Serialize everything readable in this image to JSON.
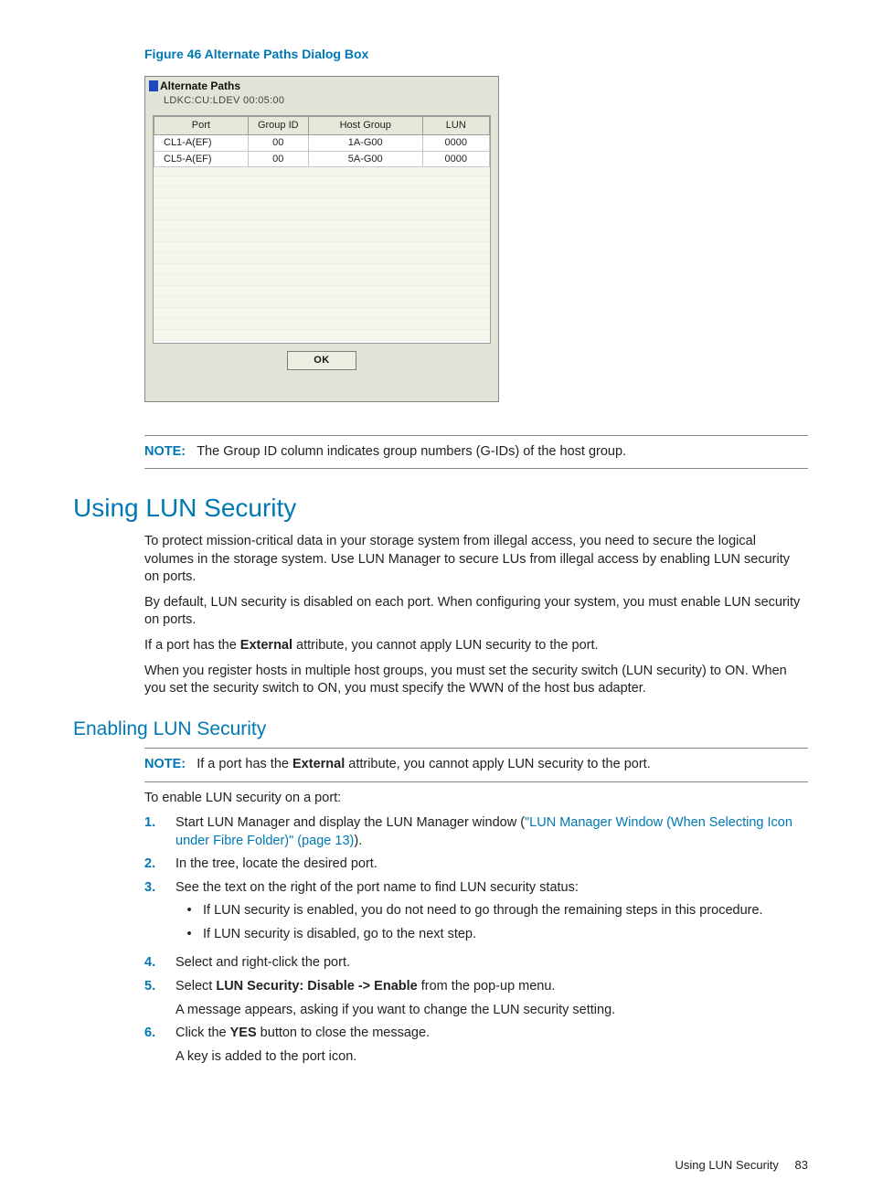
{
  "figure": {
    "caption": "Figure 46 Alternate Paths Dialog Box",
    "dialog": {
      "title": "Alternate Paths",
      "subtitle": "LDKC:CU:LDEV  00:05:00",
      "columns": [
        "Port",
        "Group ID",
        "Host Group",
        "LUN"
      ],
      "rows": [
        {
          "port": "CL1-A(EF)",
          "group_id": "00",
          "host_group": "1A-G00",
          "lun": "0000"
        },
        {
          "port": "CL5-A(EF)",
          "group_id": "00",
          "host_group": "5A-G00",
          "lun": "0000"
        }
      ],
      "ok": "OK"
    }
  },
  "note1": {
    "label": "NOTE:",
    "text": "The Group ID column indicates group numbers (G-IDs) of the host group."
  },
  "section": {
    "heading": "Using LUN Security",
    "p1": "To protect mission-critical data in your storage system from illegal access, you need to secure the logical volumes in the storage system. Use LUN Manager to secure LUs from illegal access by enabling LUN security on ports.",
    "p2": "By default, LUN security is disabled on each port. When configuring your system, you must enable LUN security on ports.",
    "p3a": "If a port has the ",
    "p3b": "External",
    "p3c": " attribute, you cannot apply LUN security to the port.",
    "p4": "When you register hosts in multiple host groups, you must set the security switch (LUN security) to ON. When you set the security switch to ON, you must specify the WWN of the host bus adapter."
  },
  "sub": {
    "heading": "Enabling LUN Security",
    "note": {
      "label": "NOTE:",
      "a": "If a port has the ",
      "b": "External",
      "c": " attribute, you cannot apply LUN security to the port."
    },
    "intro": "To enable LUN security on a port:",
    "steps": {
      "n1": "1.",
      "s1a": "Start LUN Manager and display the LUN Manager window (",
      "s1link": "\"LUN Manager Window (When Selecting Icon under Fibre Folder)\" (page 13)",
      "s1b": ").",
      "n2": "2.",
      "s2": "In the tree, locate the desired port.",
      "n3": "3.",
      "s3": "See the text on the right of the port name to find LUN security status:",
      "b1": "If LUN security is enabled, you do not need to go through the remaining steps in this procedure.",
      "b2": "If LUN security is disabled, go to the next step.",
      "n4": "4.",
      "s4": "Select and right-click the port.",
      "n5": "5.",
      "s5a": "Select ",
      "s5b": "LUN Security: Disable -> Enable",
      "s5c": " from the pop-up menu.",
      "s5d": "A message appears, asking if you want to change the LUN security setting.",
      "n6": "6.",
      "s6a": "Click the ",
      "s6b": "YES",
      "s6c": " button to close the message.",
      "s6d": "A key is added to the port icon."
    }
  },
  "footer": {
    "title": "Using LUN Security",
    "page": "83"
  }
}
